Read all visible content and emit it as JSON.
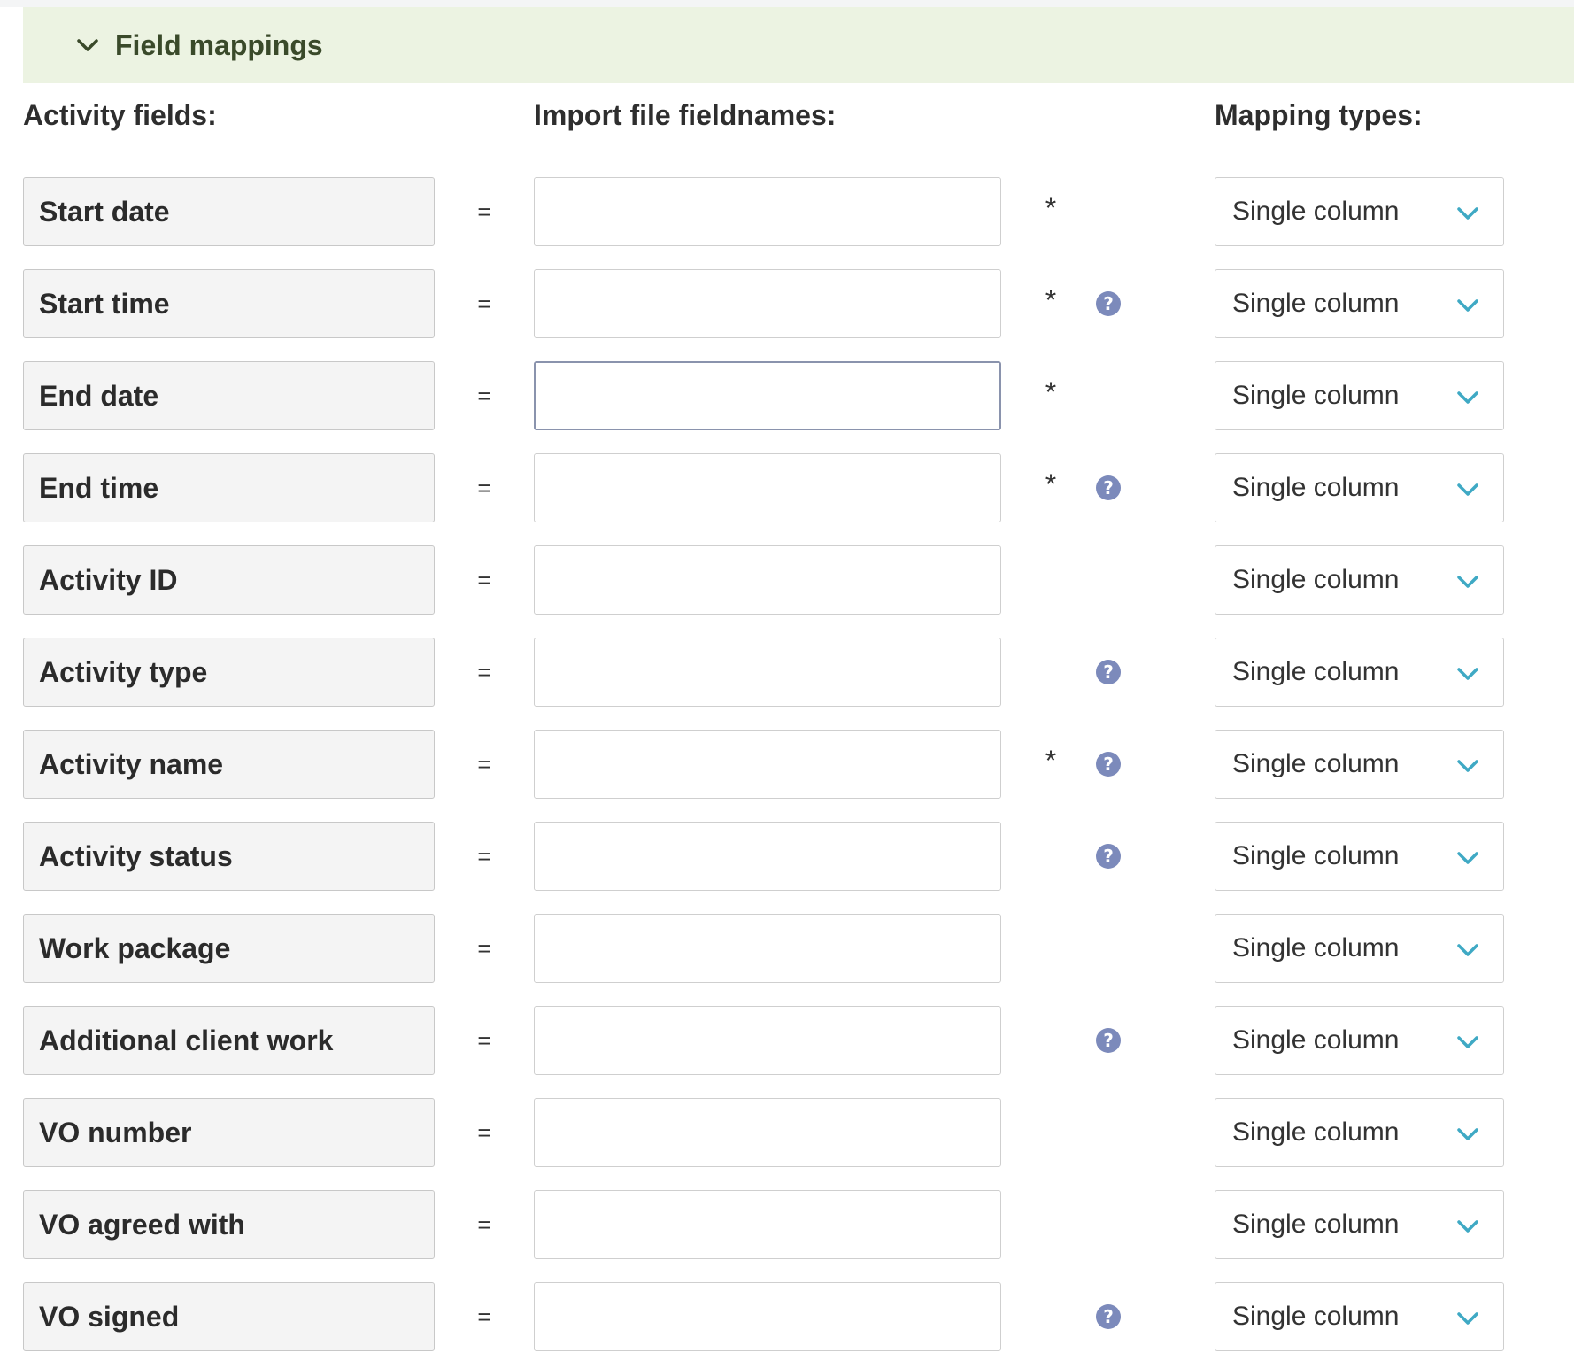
{
  "section": {
    "title": "Field mappings",
    "toggle_icon": "chevron-down-icon"
  },
  "headings": {
    "activity_fields": "Activity fields:",
    "import_fieldnames": "Import file fieldnames:",
    "mapping_types": "Mapping types:"
  },
  "colors": {
    "header_bg": "#ecf3e2",
    "header_text": "#3a4a2a",
    "help_icon": "#7c8abb",
    "chevron": "#3fa9c4"
  },
  "mappings": [
    {
      "field": "Start date",
      "equals": "=",
      "value": "",
      "required": "*",
      "help": "",
      "type": "Single column"
    },
    {
      "field": "Start time",
      "equals": "=",
      "value": "",
      "required": "*",
      "help": "?",
      "type": "Single column"
    },
    {
      "field": "End date",
      "equals": "=",
      "value": "",
      "required": "*",
      "help": "",
      "type": "Single column",
      "focused": true
    },
    {
      "field": "End time",
      "equals": "=",
      "value": "",
      "required": "*",
      "help": "?",
      "type": "Single column"
    },
    {
      "field": "Activity ID",
      "equals": "=",
      "value": "",
      "required": "",
      "help": "",
      "type": "Single column"
    },
    {
      "field": "Activity type",
      "equals": "=",
      "value": "",
      "required": "",
      "help": "?",
      "type": "Single column"
    },
    {
      "field": "Activity name",
      "equals": "=",
      "value": "",
      "required": "*",
      "help": "?",
      "type": "Single column"
    },
    {
      "field": "Activity status",
      "equals": "=",
      "value": "",
      "required": "",
      "help": "?",
      "type": "Single column"
    },
    {
      "field": "Work package",
      "equals": "=",
      "value": "",
      "required": "",
      "help": "",
      "type": "Single column"
    },
    {
      "field": "Additional client work",
      "equals": "=",
      "value": "",
      "required": "",
      "help": "?",
      "type": "Single column"
    },
    {
      "field": "VO number",
      "equals": "=",
      "value": "",
      "required": "",
      "help": "",
      "type": "Single column"
    },
    {
      "field": "VO agreed with",
      "equals": "=",
      "value": "",
      "required": "",
      "help": "",
      "type": "Single column"
    },
    {
      "field": "VO signed",
      "equals": "=",
      "value": "",
      "required": "",
      "help": "?",
      "type": "Single column"
    }
  ]
}
